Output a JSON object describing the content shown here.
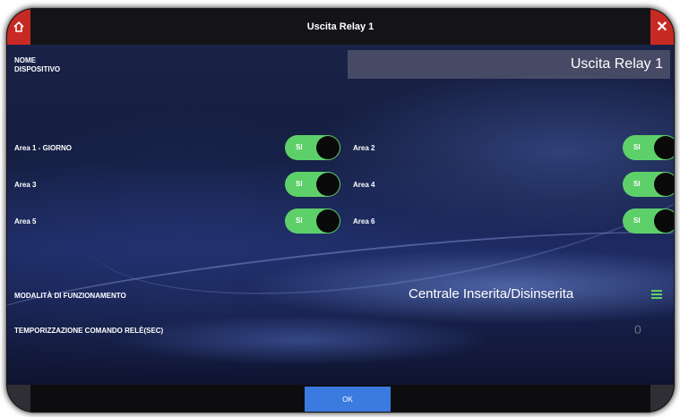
{
  "window": {
    "title": "Uscita Relay 1"
  },
  "device": {
    "label": "NOME\nDISPOSITIVO",
    "value": "Uscita Relay 1"
  },
  "areas": [
    {
      "label": "Area 1 - GIORNO",
      "toggle": "SI"
    },
    {
      "label": "Area 2",
      "toggle": "SI"
    },
    {
      "label": "Area 3",
      "toggle": "SI"
    },
    {
      "label": "Area 4",
      "toggle": "SI"
    },
    {
      "label": "Area 5",
      "toggle": "SI"
    },
    {
      "label": "Area 6",
      "toggle": "SI"
    }
  ],
  "mode": {
    "label": "MODALITÀ DI FUNZIONAMENTO",
    "value": "Centrale Inserita/Disinserita",
    "icon": "menu-icon"
  },
  "timer": {
    "label": "TEMPORIZZAZIONE COMANDO RELÈ(SEC)",
    "value": "0"
  },
  "footer": {
    "ok_label": "OK"
  },
  "colors": {
    "accent_red": "#c62a23",
    "toggle_green": "#5ed06a",
    "ok_blue": "#3b7be0"
  }
}
